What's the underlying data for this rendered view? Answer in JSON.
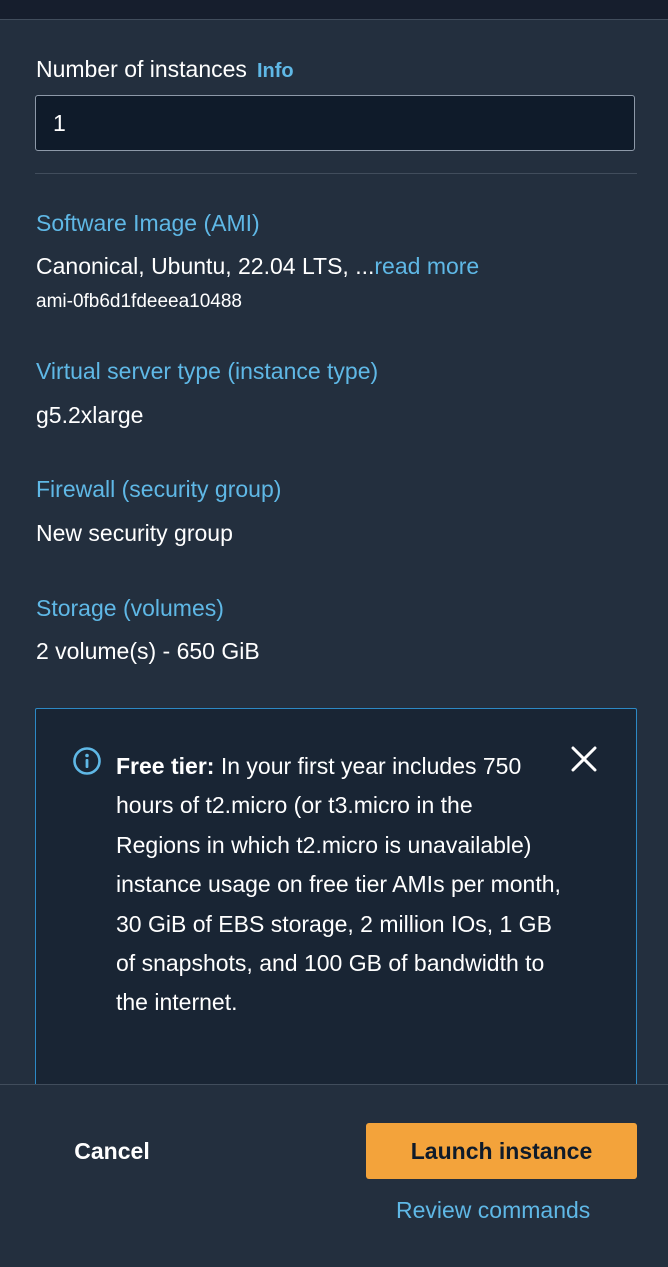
{
  "instances": {
    "label": "Number of instances",
    "info_link": "Info",
    "value": "1"
  },
  "summary": {
    "ami": {
      "title": "Software Image (AMI)",
      "value": "Canonical, Ubuntu, 22.04 LTS, ...",
      "read_more": "read more",
      "id": "ami-0fb6d1fdeeea10488"
    },
    "instance_type": {
      "title": "Virtual server type (instance type)",
      "value": "g5.2xlarge"
    },
    "firewall": {
      "title": "Firewall (security group)",
      "value": "New security group"
    },
    "storage": {
      "title": "Storage (volumes)",
      "value": "2 volume(s) - 650 GiB"
    }
  },
  "free_tier_alert": {
    "heading": "Free tier:",
    "body": "In your first year includes 750 hours of t2.micro (or t3.micro in the Regions in which t2.micro is unavailable) instance usage on free tier AMIs per month, 30 GiB of EBS storage, 2 million IOs, 1 GB of snapshots, and 100 GB of bandwidth to the internet.",
    "icon": "info-circle-icon",
    "close_icon": "close-icon"
  },
  "footer": {
    "cancel_label": "Cancel",
    "launch_label": "Launch instance",
    "review_label": "Review commands"
  },
  "colors": {
    "background": "#232f3e",
    "link": "#5fb8e6",
    "primary_button": "#f3a33b",
    "alert_border": "#2c89c5",
    "alert_background": "#192534"
  }
}
